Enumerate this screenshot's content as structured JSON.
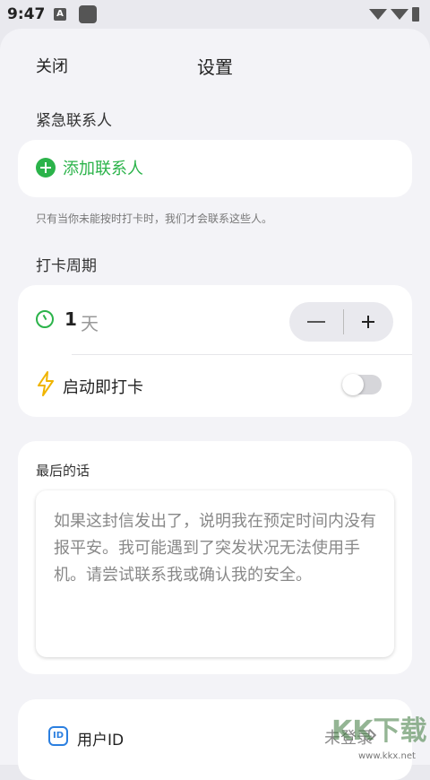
{
  "status_bar": {
    "time": "9:47",
    "notif_letter": "A"
  },
  "header": {
    "close_label": "关闭",
    "title": "设置"
  },
  "emergency": {
    "section_label": "紧急联系人",
    "add_label": "添加联系人",
    "hint": "只有当你未能按时打卡时，我们才会联系这些人。"
  },
  "checkin": {
    "section_label": "打卡周期",
    "value": "1",
    "unit": "天",
    "autostart_label": "启动即打卡",
    "autostart_on": false
  },
  "last_words": {
    "label": "最后的话",
    "text": "如果这封信发出了，说明我在预定时间内没有报平安。我可能遇到了突发状况无法使用手机。请尝试联系我或确认我的安全。"
  },
  "account": {
    "icon_text": "ID",
    "userid_label": "用户ID",
    "userid_value": "未登录"
  },
  "watermark": {
    "text": "KK下载",
    "url": "www.kkx.net"
  },
  "colors": {
    "accent_green": "#2bb34a",
    "accent_blue": "#2b7fe0",
    "bolt": "#f0b400"
  }
}
